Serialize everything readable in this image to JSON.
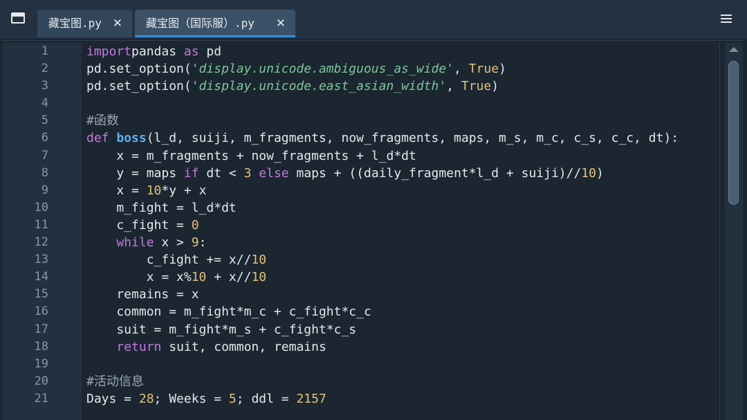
{
  "tabs": [
    {
      "title": "藏宝图.py",
      "close": "✕",
      "active": false
    },
    {
      "title": "藏宝图（国际服）.py",
      "close": "✕",
      "active": true
    }
  ],
  "icons": {
    "window": "window-icon",
    "menu": "hamburger-menu-icon",
    "close": "close-icon"
  },
  "colors": {
    "background": "#1b2631",
    "keyword": "#c678dd",
    "function": "#61afef",
    "string": "#7ec699",
    "number": "#e5c07b",
    "accent": "#2f8fde"
  },
  "code_lines": [
    {
      "n": "1",
      "tokens": [
        [
          "kw",
          "import"
        ],
        [
          "",
          "pandas "
        ],
        [
          "kw",
          "as"
        ],
        [
          "",
          " pd"
        ]
      ]
    },
    {
      "n": "2",
      "tokens": [
        [
          "",
          "pd.set_option("
        ],
        [
          "str",
          "'display.unicode.ambiguous_as_wide'"
        ],
        [
          "",
          ", "
        ],
        [
          "cn",
          "True"
        ],
        [
          "",
          ")"
        ]
      ]
    },
    {
      "n": "3",
      "tokens": [
        [
          "",
          "pd.set_option("
        ],
        [
          "str",
          "'display.unicode.east_asian_width'"
        ],
        [
          "",
          ", "
        ],
        [
          "cn",
          "True"
        ],
        [
          "",
          ")"
        ]
      ]
    },
    {
      "n": "4",
      "tokens": []
    },
    {
      "n": "5",
      "tokens": [
        [
          "cm",
          "#函数"
        ]
      ]
    },
    {
      "n": "6",
      "tokens": [
        [
          "kw",
          "def"
        ],
        [
          "",
          " "
        ],
        [
          "fn",
          "boss"
        ],
        [
          "",
          "(l_d, suiji, m_fragments, now_fragments, maps, m_s, m_c, c_s, c_c, dt):"
        ]
      ]
    },
    {
      "n": "7",
      "tokens": [
        [
          "",
          "    x = m_fragments + now_fragments + l_d*dt"
        ]
      ]
    },
    {
      "n": "8",
      "tokens": [
        [
          "",
          "    y = maps "
        ],
        [
          "kw",
          "if"
        ],
        [
          "",
          " dt < "
        ],
        [
          "num",
          "3"
        ],
        [
          "",
          " "
        ],
        [
          "kw",
          "else"
        ],
        [
          "",
          " maps + ((daily_fragment*l_d + suiji)//"
        ],
        [
          "num",
          "10"
        ],
        [
          "",
          ")"
        ]
      ]
    },
    {
      "n": "9",
      "tokens": [
        [
          "",
          "    x = "
        ],
        [
          "num",
          "10"
        ],
        [
          "",
          "*y + x"
        ]
      ]
    },
    {
      "n": "10",
      "tokens": [
        [
          "",
          "    m_fight = l_d*dt"
        ]
      ]
    },
    {
      "n": "11",
      "tokens": [
        [
          "",
          "    c_fight = "
        ],
        [
          "num",
          "0"
        ]
      ]
    },
    {
      "n": "12",
      "tokens": [
        [
          "",
          "    "
        ],
        [
          "kw",
          "while"
        ],
        [
          "",
          " x > "
        ],
        [
          "num",
          "9"
        ],
        [
          "",
          ":"
        ]
      ]
    },
    {
      "n": "13",
      "tokens": [
        [
          "",
          "        c_fight += x//"
        ],
        [
          "num",
          "10"
        ]
      ]
    },
    {
      "n": "14",
      "tokens": [
        [
          "",
          "        x = x%"
        ],
        [
          "num",
          "10"
        ],
        [
          "",
          " + x//"
        ],
        [
          "num",
          "10"
        ]
      ]
    },
    {
      "n": "15",
      "tokens": [
        [
          "",
          "    remains = x"
        ]
      ]
    },
    {
      "n": "16",
      "tokens": [
        [
          "",
          "    common = m_fight*m_c + c_fight*c_c"
        ]
      ]
    },
    {
      "n": "17",
      "tokens": [
        [
          "",
          "    suit = m_fight*m_s + c_fight*c_s"
        ]
      ]
    },
    {
      "n": "18",
      "tokens": [
        [
          "",
          "    "
        ],
        [
          "kw",
          "return"
        ],
        [
          "",
          " suit, common, remains"
        ]
      ]
    },
    {
      "n": "19",
      "tokens": []
    },
    {
      "n": "20",
      "tokens": [
        [
          "cm",
          "#活动信息"
        ]
      ]
    },
    {
      "n": "21",
      "tokens": [
        [
          "",
          "Days = "
        ],
        [
          "num",
          "28"
        ],
        [
          "",
          "; Weeks = "
        ],
        [
          "num",
          "5"
        ],
        [
          "",
          "; ddl = "
        ],
        [
          "num",
          "2157"
        ]
      ]
    }
  ]
}
